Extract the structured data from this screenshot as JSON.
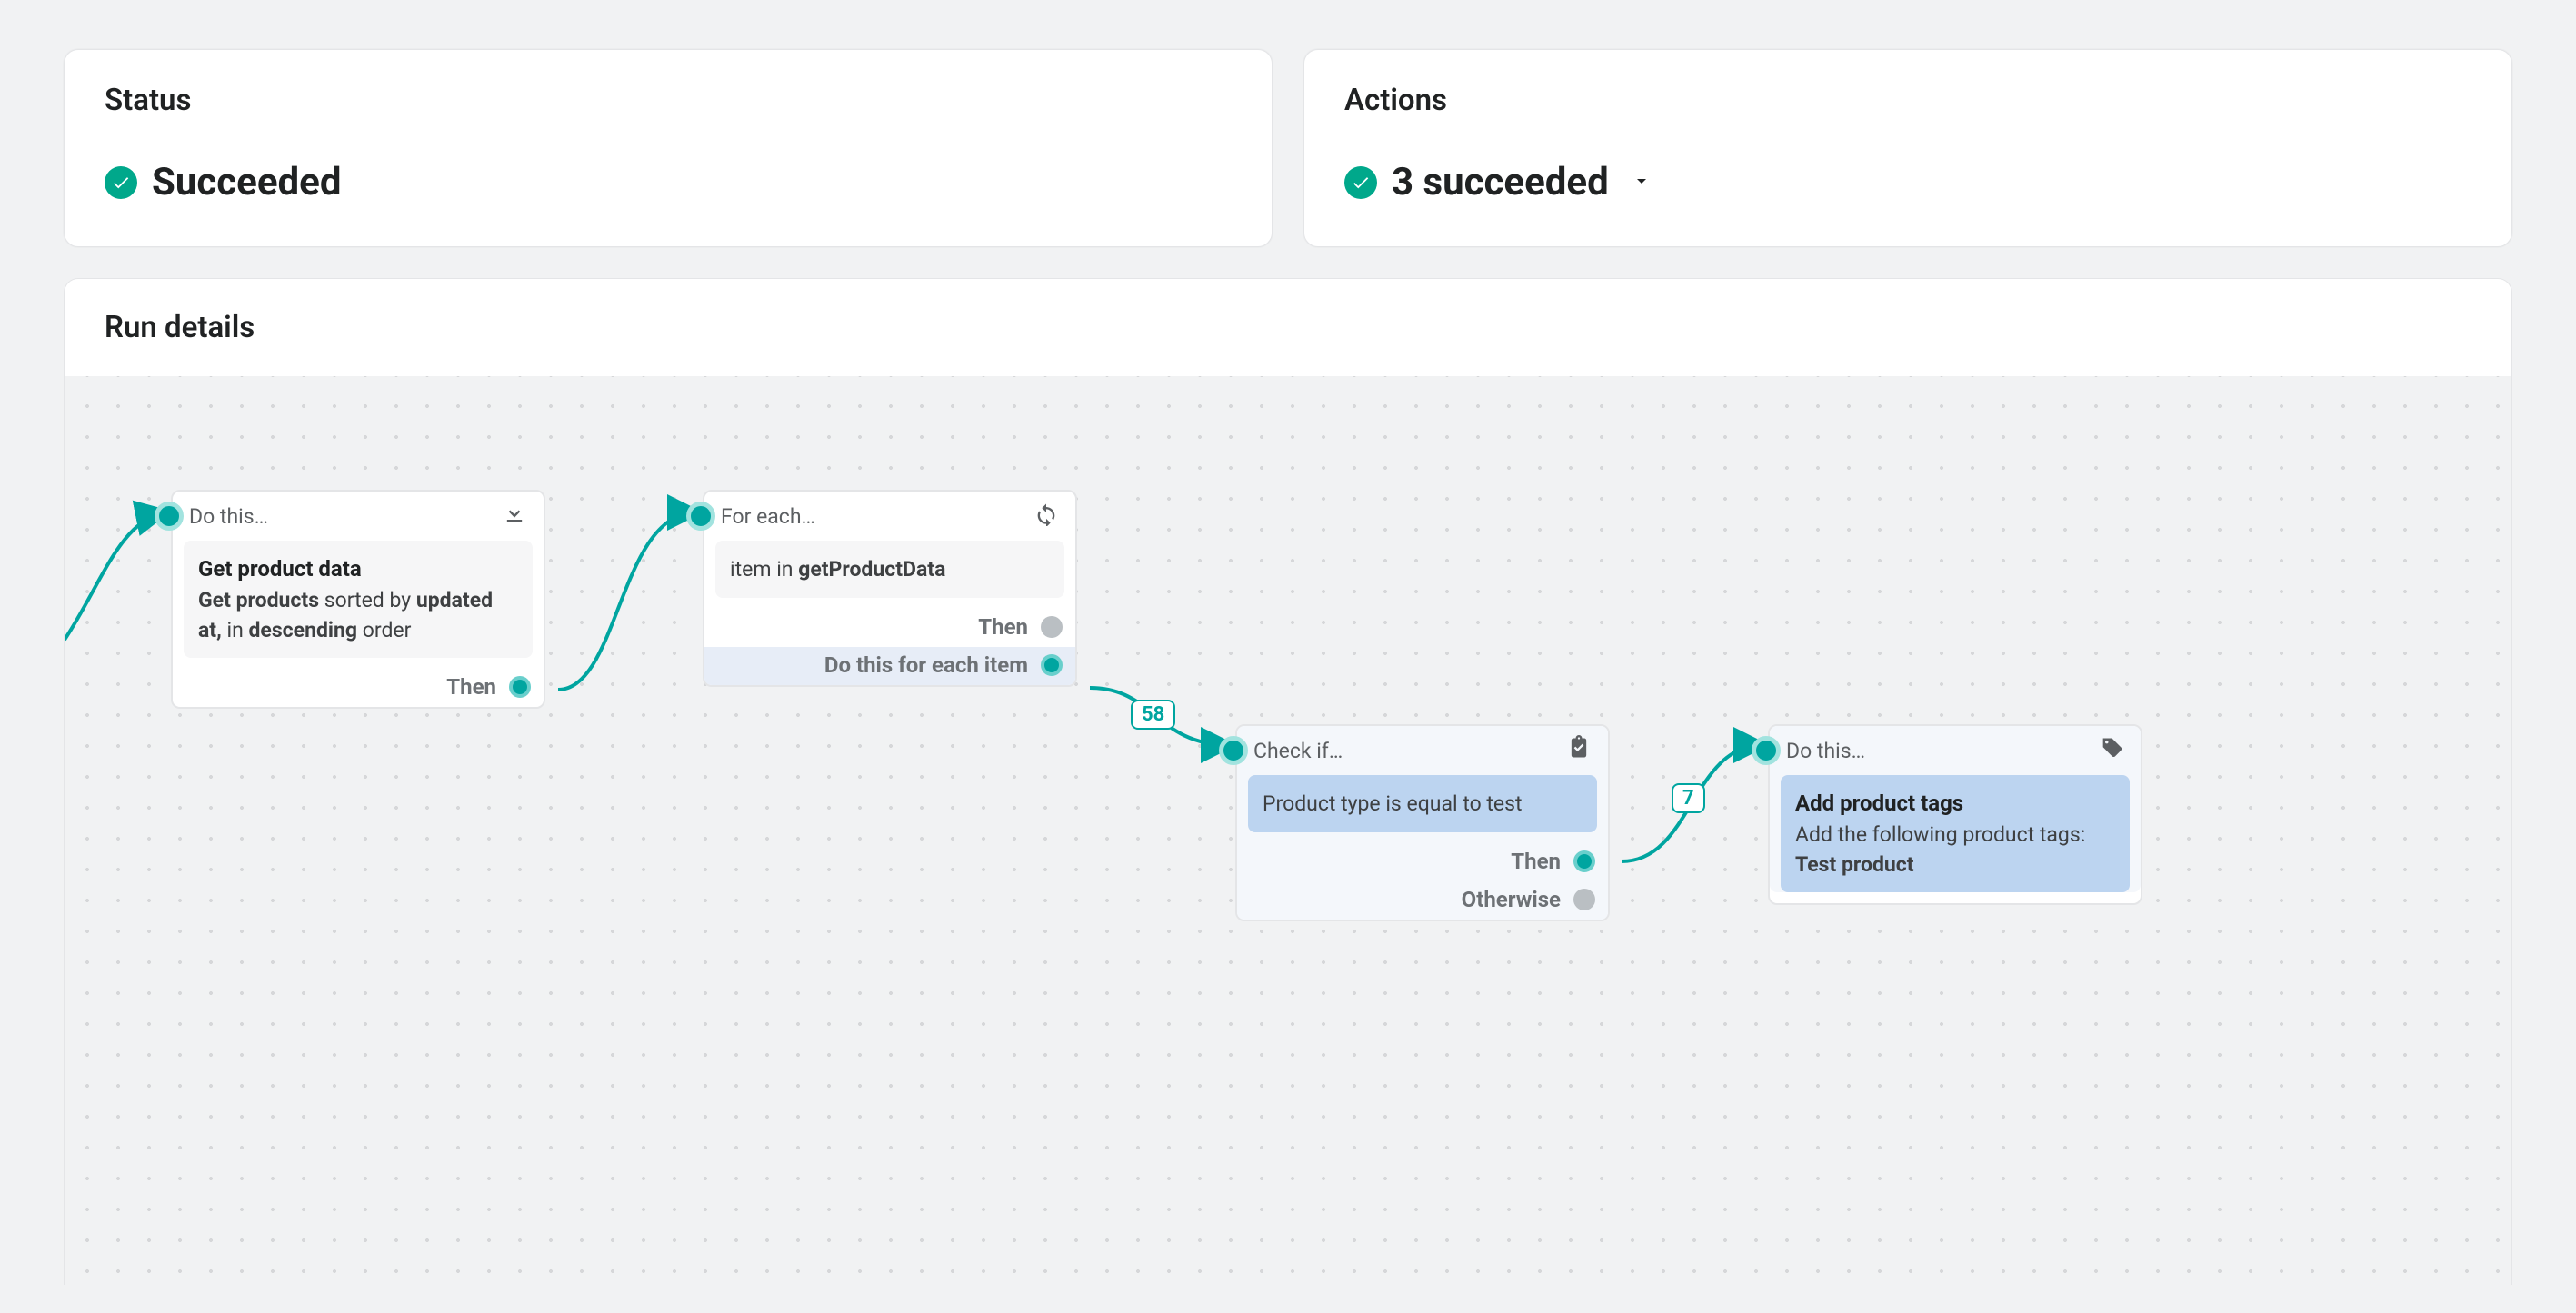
{
  "status": {
    "panel_title": "Status",
    "value": "Succeeded"
  },
  "actions": {
    "panel_title": "Actions",
    "value": "3 succeeded"
  },
  "run_details": {
    "panel_title": "Run details"
  },
  "flow": {
    "badges": {
      "b1": "58",
      "b2": "7"
    },
    "node1": {
      "header": "Do this…",
      "title": "Get product data",
      "desc_prefix": "Get products",
      "desc_mid1": " sorted by ",
      "desc_bold1": "updated at,",
      "desc_mid2": " in ",
      "desc_bold2": "descending",
      "desc_suffix": " order",
      "output": "Then"
    },
    "node2": {
      "header": "For each…",
      "body_prefix": "item in ",
      "body_bold": "getProductData",
      "output1": "Then",
      "output2": "Do this for each item"
    },
    "node3": {
      "header": "Check if…",
      "body": "Product type is equal to test",
      "output1": "Then",
      "output2": "Otherwise"
    },
    "node4": {
      "header": "Do this…",
      "title": "Add product tags",
      "subtitle": "Add the following product tags:",
      "tag": "Test product"
    }
  }
}
